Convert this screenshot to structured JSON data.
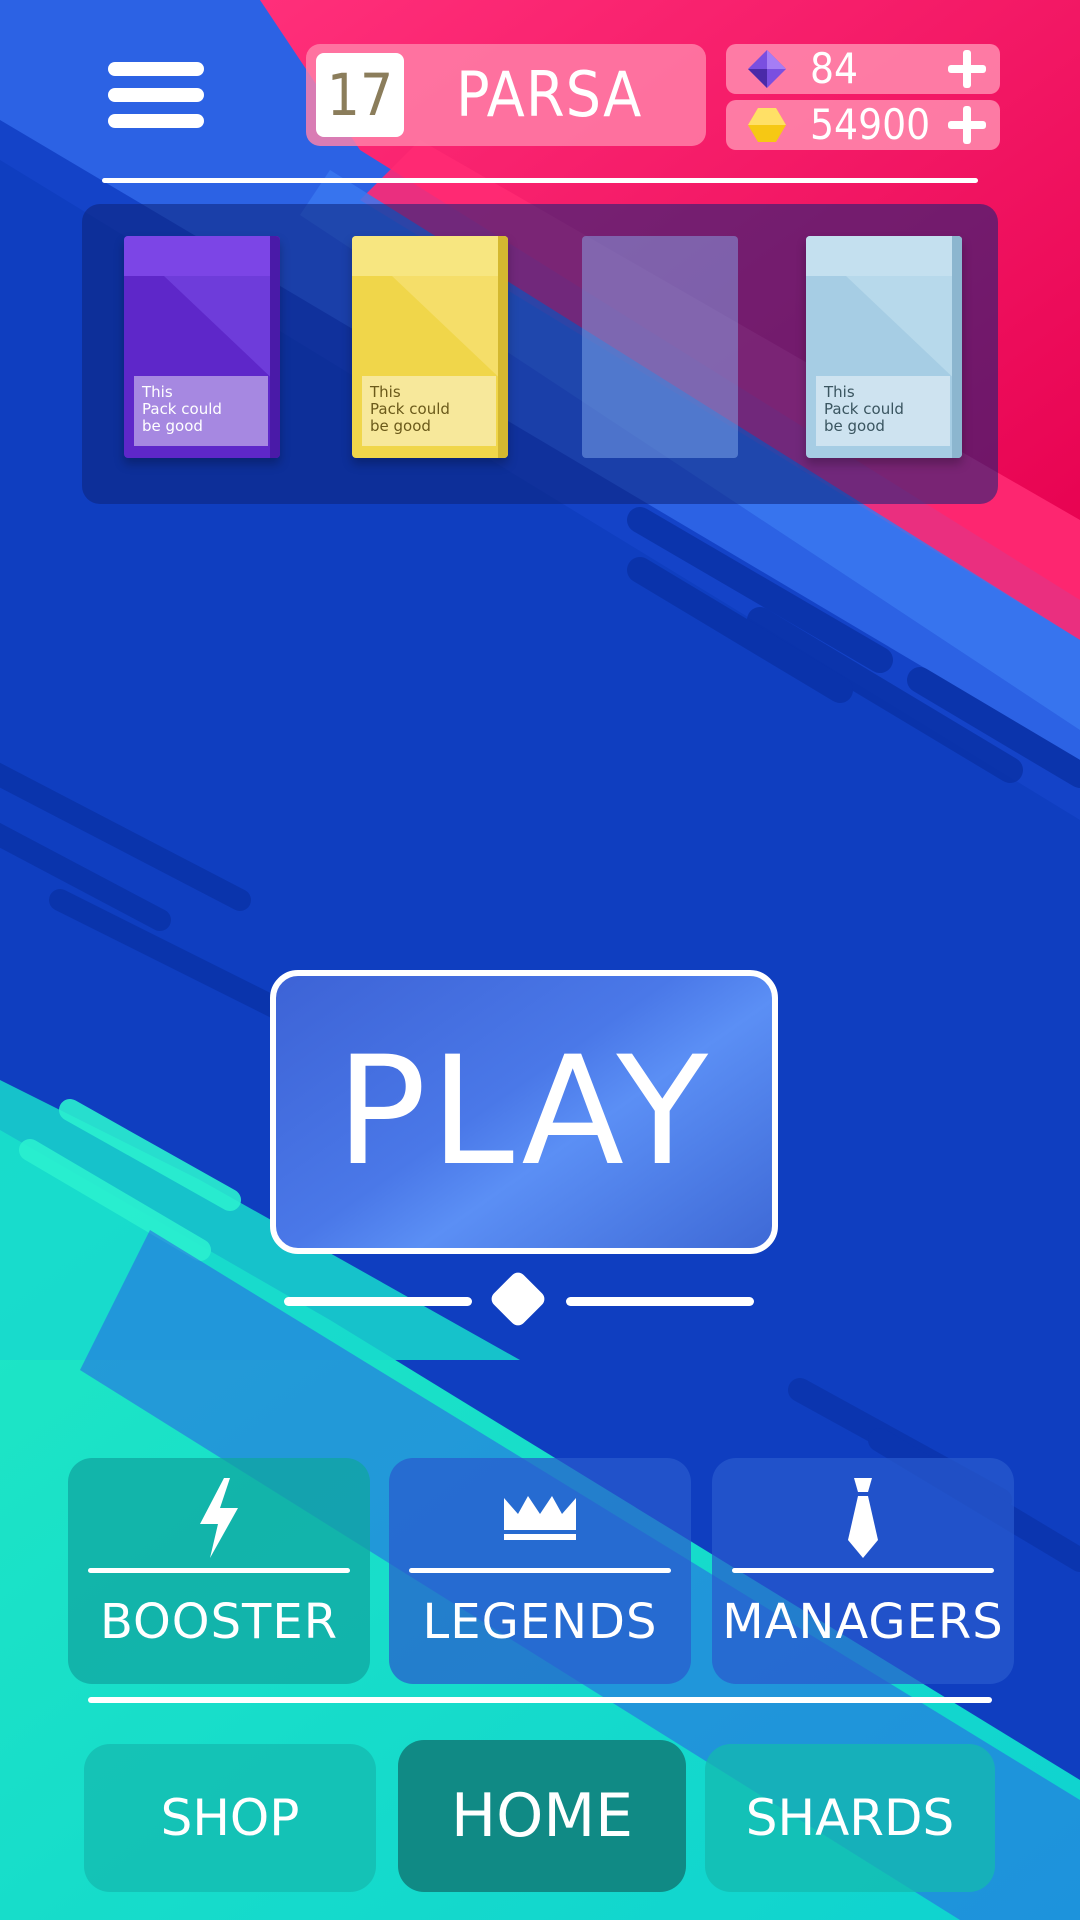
{
  "header": {
    "menu_icon": "hamburger-menu-icon",
    "level": "17",
    "player_name": "PARSA",
    "gems": {
      "icon": "purple-gem-icon",
      "value": "84",
      "add_icon": "plus-icon"
    },
    "coins": {
      "icon": "gold-coin-icon",
      "value": "54900",
      "add_icon": "plus-icon"
    }
  },
  "packs": [
    {
      "color": "purple",
      "label_lines": [
        "This",
        "Pack could",
        "be good"
      ],
      "text_color": "#ffffff"
    },
    {
      "color": "yellow",
      "label_lines": [
        "This",
        "Pack could",
        "be good"
      ],
      "text_color": "#6b5a1a"
    },
    {
      "color": "empty",
      "label_lines": []
    },
    {
      "color": "light-blue",
      "label_lines": [
        "This",
        "Pack could",
        "be good"
      ],
      "text_color": "#3a5560"
    }
  ],
  "play": {
    "label": "PLAY"
  },
  "features": {
    "booster": {
      "label": "BOOSTER",
      "icon": "lightning-icon"
    },
    "legends": {
      "label": "LEGENDS",
      "icon": "crown-icon"
    },
    "managers": {
      "label": "MANAGERS",
      "icon": "tie-icon"
    }
  },
  "nav": {
    "shop": "SHOP",
    "home": "HOME",
    "shards": "SHARDS",
    "active": "home"
  },
  "colors": {
    "background_blue": "#1442c7",
    "accent_pink": "#ff1f6b",
    "accent_teal": "#16e0c8",
    "pack_purple": "#6a2fd6",
    "pack_yellow": "#f2da52",
    "pack_light_blue": "#a9d0e6"
  }
}
